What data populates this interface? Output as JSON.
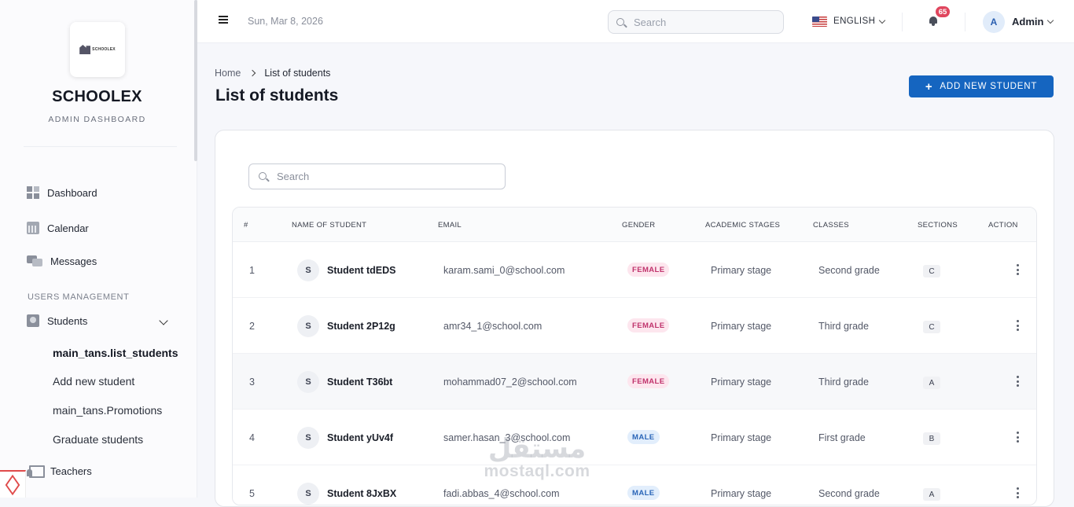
{
  "brand": {
    "name": "SCHOOLEX",
    "subtitle": "ADMIN DASHBOARD",
    "logo_text": "SCHOOLEX"
  },
  "sidebar": {
    "items": [
      {
        "label": "Dashboard",
        "icon": "dashboard-icon"
      },
      {
        "label": "Calendar",
        "icon": "calendar-icon"
      },
      {
        "label": "Messages",
        "icon": "messages-icon"
      }
    ],
    "section_label": "USERS MANAGEMENT",
    "students": {
      "label": "Students",
      "icon": "students-icon",
      "sub_items": [
        "main_tans.list_students",
        "Add new student",
        "main_tans.Promotions",
        "Graduate students"
      ]
    },
    "teachers": {
      "label": "Teachers",
      "icon": "teachers-icon"
    }
  },
  "topbar": {
    "date": "Sun, Mar 8, 2026",
    "search_placeholder": "Search",
    "language": "ENGLISH",
    "notification_count": "65",
    "user_initial": "A",
    "user_name": "Admin"
  },
  "breadcrumb": {
    "home": "Home",
    "current": "List of students"
  },
  "page_title": "List of students",
  "add_button_label": "ADD NEW STUDENT",
  "table_search_placeholder": "Search",
  "table": {
    "headers": [
      "#",
      "NAME OF STUDENT",
      "EMAIL",
      "GENDER",
      "ACADEMIC STAGES",
      "CLASSES",
      "SECTIONS",
      "ACTION"
    ],
    "rows": [
      {
        "num": "1",
        "initial": "S",
        "name": "Student tdEDS",
        "email": "karam.sami_0@school.com",
        "gender": "FEMALE",
        "stage": "Primary stage",
        "class": "Second grade",
        "section": "C"
      },
      {
        "num": "2",
        "initial": "S",
        "name": "Student 2P12g",
        "email": "amr34_1@school.com",
        "gender": "FEMALE",
        "stage": "Primary stage",
        "class": "Third grade",
        "section": "C"
      },
      {
        "num": "3",
        "initial": "S",
        "name": "Student T36bt",
        "email": "mohammad07_2@school.com",
        "gender": "FEMALE",
        "stage": "Primary stage",
        "class": "Third grade",
        "section": "A"
      },
      {
        "num": "4",
        "initial": "S",
        "name": "Student yUv4f",
        "email": "samer.hasan_3@school.com",
        "gender": "MALE",
        "stage": "Primary stage",
        "class": "First grade",
        "section": "B"
      },
      {
        "num": "5",
        "initial": "S",
        "name": "Student 8JxBX",
        "email": "fadi.abbas_4@school.com",
        "gender": "MALE",
        "stage": "Primary stage",
        "class": "Second grade",
        "section": "A"
      }
    ]
  },
  "watermark": {
    "arabic": "مستقل",
    "latin": "mostaql.com"
  },
  "colors": {
    "primary": "#1565c0",
    "female_badge": "#c0336c",
    "male_badge": "#2b66b8",
    "notification": "#e0465e"
  }
}
